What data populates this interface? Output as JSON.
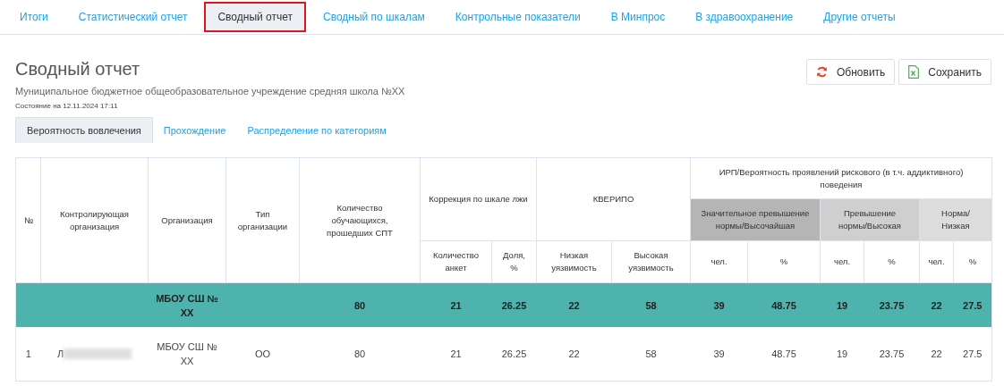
{
  "tabs": [
    {
      "label": "Итоги",
      "selected": false,
      "highlighted": false
    },
    {
      "label": "Статистический отчет",
      "selected": false,
      "highlighted": false
    },
    {
      "label": "Сводный отчет",
      "selected": true,
      "highlighted": true
    },
    {
      "label": "Сводный по шкалам",
      "selected": false,
      "highlighted": false
    },
    {
      "label": "Контрольные показатели",
      "selected": false,
      "highlighted": false
    },
    {
      "label": "В Минпрос",
      "selected": false,
      "highlighted": false
    },
    {
      "label": "В здравоохранение",
      "selected": false,
      "highlighted": false
    },
    {
      "label": "Другие отчеты",
      "selected": false,
      "highlighted": false
    }
  ],
  "title": "Сводный отчет",
  "subtitle": "Муниципальное бюджетное общеобразовательное учреждение средняя школа №XX",
  "status": "Состояние на 12.11.2024 17:11",
  "buttons": [
    {
      "kind": "refresh",
      "label": "Обновить"
    },
    {
      "kind": "excel",
      "label": "Сохранить"
    }
  ],
  "subtabs": [
    {
      "label": "Вероятность вовлечения",
      "selected": true
    },
    {
      "label": "Прохождение",
      "selected": false
    },
    {
      "label": "Распределение по категориям",
      "selected": false
    }
  ],
  "table": {
    "header_rows": [
      [
        {
          "text": "№",
          "rowspan": 3
        },
        {
          "text": "Контролирующая организация",
          "rowspan": 3
        },
        {
          "text": "Организация",
          "rowspan": 3
        },
        {
          "text": "Тип организации",
          "rowspan": 3
        },
        {
          "text": "Количество обучающихся, прошедших СПТ",
          "rowspan": 3
        },
        {
          "text": "Коррекция по шкале лжи",
          "colspan": 2,
          "rowspan": 2
        },
        {
          "text": "КВЕРИПО",
          "colspan": 2,
          "rowspan": 2
        },
        {
          "text": "ИРП/Вероятность проявлений рискового (в т.ч. аддиктивного) поведения",
          "colspan": 6
        }
      ],
      [
        {
          "text": "Значительное превышение нормы/Высочайшая",
          "colspan": 2,
          "color": "#b5b5b5"
        },
        {
          "text": "Превышение нормы/Высокая",
          "colspan": 2,
          "color": "#cfcfcf"
        },
        {
          "text": "Норма/ Низкая",
          "colspan": 2,
          "color": "#dcdcdc"
        }
      ],
      [
        {
          "text": "Количество анкет"
        },
        {
          "text": "Доля, %"
        },
        {
          "text": "Низкая уязвимость"
        },
        {
          "text": "Высокая уязвимость"
        },
        {
          "text": "чел."
        },
        {
          "text": "%"
        },
        {
          "text": "чел."
        },
        {
          "text": "%"
        },
        {
          "text": "чел."
        },
        {
          "text": "%"
        }
      ]
    ],
    "rows": [
      {
        "kind": "total",
        "cells": [
          "",
          "",
          "МБОУ СШ № XX",
          "",
          "80",
          "21",
          "26.25",
          "22",
          "58",
          "39",
          "48.75",
          "19",
          "23.75",
          "22",
          "27.5"
        ]
      },
      {
        "kind": "item",
        "redacted": true,
        "cells": [
          "1",
          "Л",
          "МБОУ СШ № XX",
          "ОО",
          "80",
          "21",
          "26.25",
          "22",
          "58",
          "39",
          "48.75",
          "19",
          "23.75",
          "22",
          "27.5"
        ]
      }
    ]
  }
}
